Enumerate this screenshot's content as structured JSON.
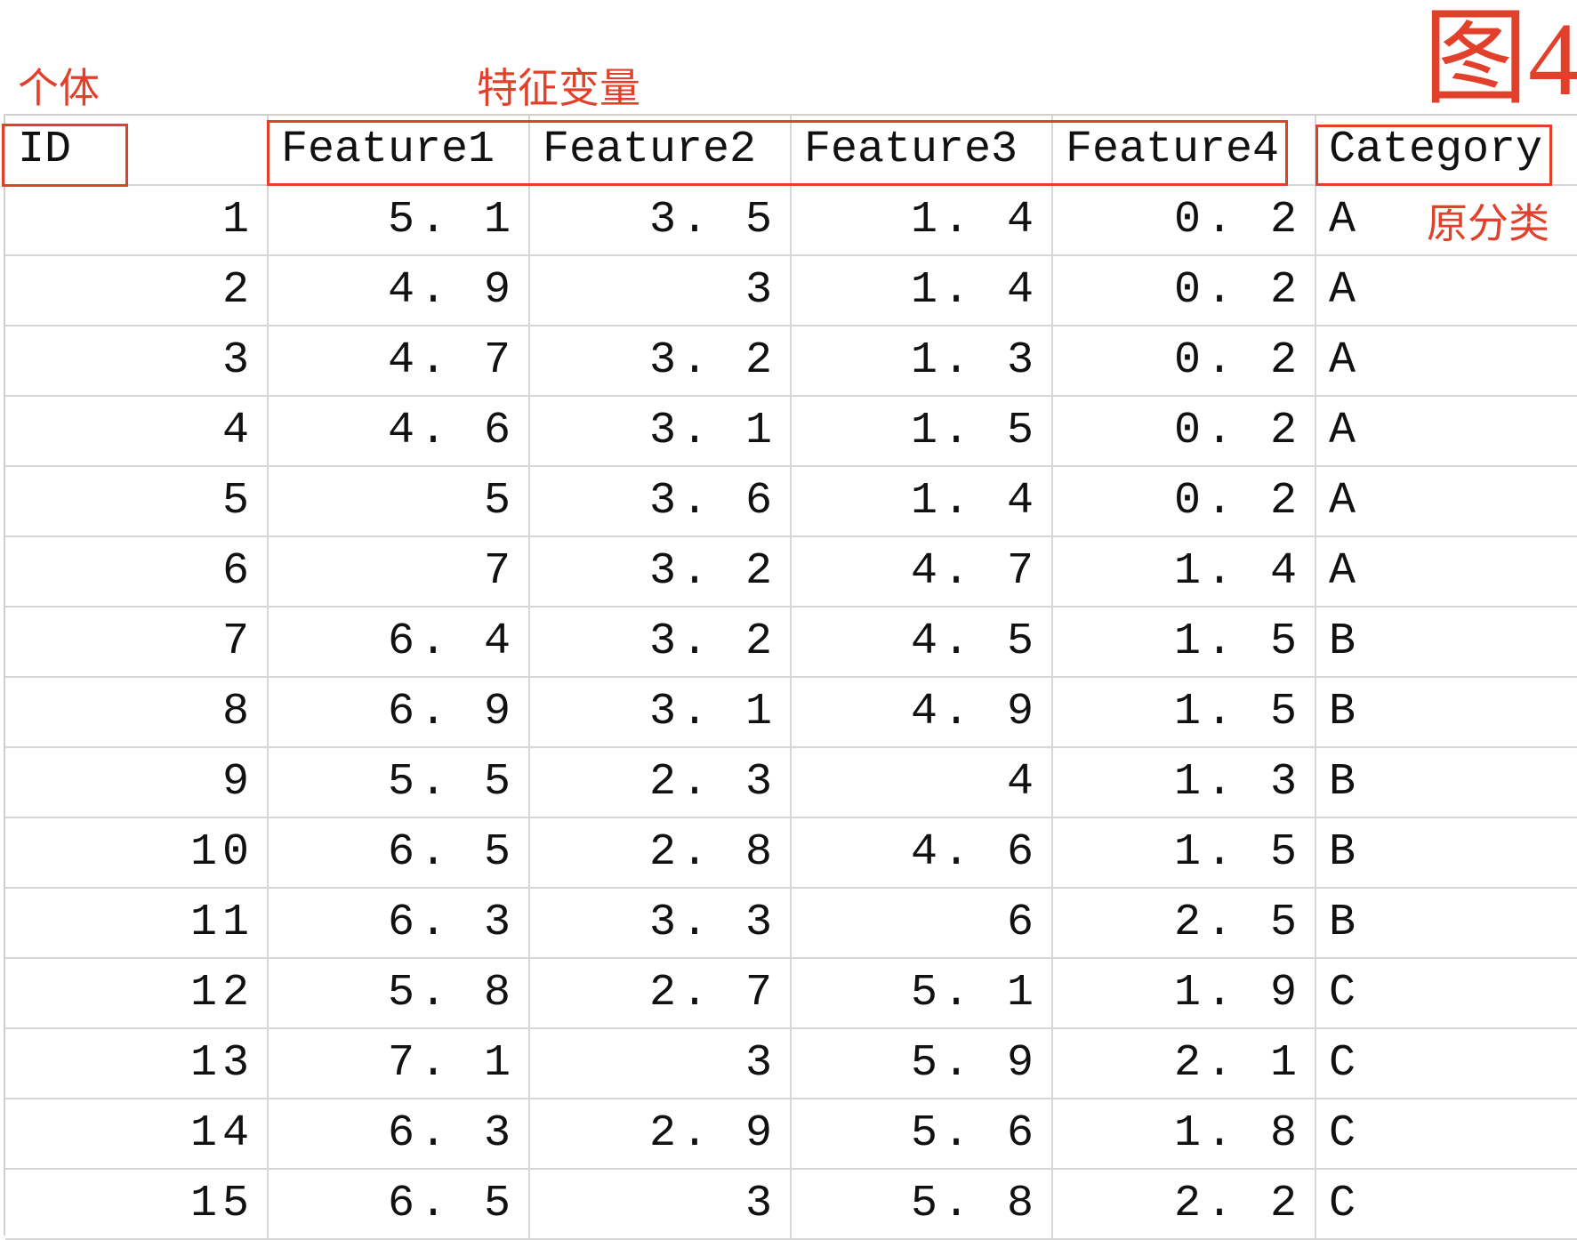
{
  "annotations": {
    "id_label": "个体",
    "features_label": "特征变量",
    "figure_label": "图4",
    "category_label": "原分类"
  },
  "table": {
    "headers": [
      "ID",
      "Feature1",
      "Feature2",
      "Feature3",
      "Feature4",
      "Category"
    ],
    "rows": [
      [
        "1",
        "5. 1",
        "3. 5",
        "1. 4",
        "0. 2",
        "A"
      ],
      [
        "2",
        "4. 9",
        "3",
        "1. 4",
        "0. 2",
        "A"
      ],
      [
        "3",
        "4. 7",
        "3. 2",
        "1. 3",
        "0. 2",
        "A"
      ],
      [
        "4",
        "4. 6",
        "3. 1",
        "1. 5",
        "0. 2",
        "A"
      ],
      [
        "5",
        "5",
        "3. 6",
        "1. 4",
        "0. 2",
        "A"
      ],
      [
        "6",
        "7",
        "3. 2",
        "4. 7",
        "1. 4",
        "A"
      ],
      [
        "7",
        "6. 4",
        "3. 2",
        "4. 5",
        "1. 5",
        "B"
      ],
      [
        "8",
        "6. 9",
        "3. 1",
        "4. 9",
        "1. 5",
        "B"
      ],
      [
        "9",
        "5. 5",
        "2. 3",
        "4",
        "1. 3",
        "B"
      ],
      [
        "10",
        "6. 5",
        "2. 8",
        "4. 6",
        "1. 5",
        "B"
      ],
      [
        "11",
        "6. 3",
        "3. 3",
        "6",
        "2. 5",
        "B"
      ],
      [
        "12",
        "5. 8",
        "2. 7",
        "5. 1",
        "1. 9",
        "C"
      ],
      [
        "13",
        "7. 1",
        "3",
        "5. 9",
        "2. 1",
        "C"
      ],
      [
        "14",
        "6. 3",
        "2. 9",
        "5. 6",
        "1. 8",
        "C"
      ],
      [
        "15",
        "6. 5",
        "3",
        "5. 8",
        "2. 2",
        "C"
      ]
    ]
  },
  "colors": {
    "annotation_red": "#e1412b",
    "gridline": "#d6d6d6"
  }
}
